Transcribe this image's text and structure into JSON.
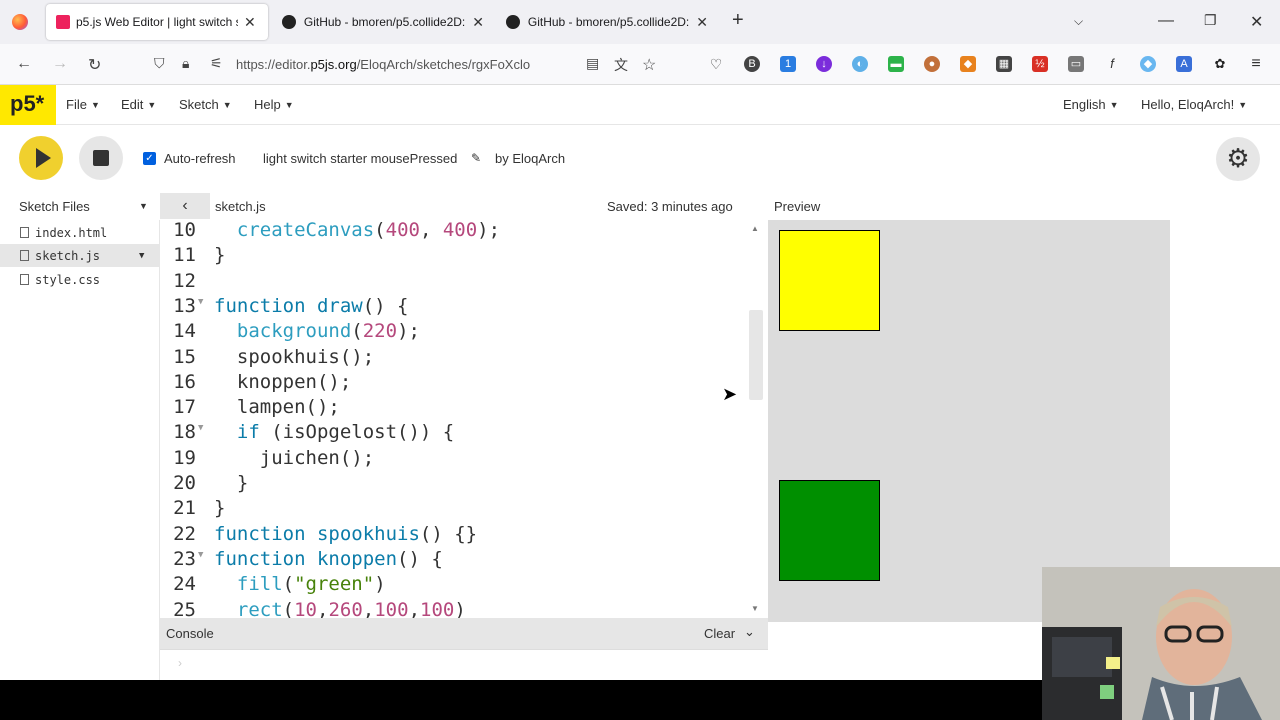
{
  "browser": {
    "tabs": [
      {
        "title": "p5.js Web Editor | light switch starte"
      },
      {
        "title": "GitHub - bmoren/p5.collide2D:"
      },
      {
        "title": "GitHub - bmoren/p5.collide2D:"
      }
    ],
    "url_prefix": "https://editor.",
    "url_domain": "p5js.org",
    "url_path": "/EloqArch/sketches/rgxFoXclo"
  },
  "app": {
    "logo": "p5*",
    "menu": [
      "File",
      "Edit",
      "Sketch",
      "Help"
    ],
    "language": "English",
    "greeting": "Hello, EloqArch!"
  },
  "toolbar": {
    "autorefresh_label": "Auto-refresh",
    "sketch_name": "light switch starter mousePressed",
    "author": "by EloqArch"
  },
  "files": {
    "header": "Sketch Files",
    "items": [
      "index.html",
      "sketch.js",
      "style.css"
    ]
  },
  "editor": {
    "filename": "sketch.js",
    "saved_status": "Saved: 3 minutes ago",
    "lines": [
      {
        "n": "10",
        "code": "  createCanvas(400, 400);"
      },
      {
        "n": "11",
        "code": "}"
      },
      {
        "n": "12",
        "code": ""
      },
      {
        "n": "13",
        "code": "function draw() {"
      },
      {
        "n": "14",
        "code": "  background(220);"
      },
      {
        "n": "15",
        "code": "  spookhuis();"
      },
      {
        "n": "16",
        "code": "  knoppen();"
      },
      {
        "n": "17",
        "code": "  lampen();"
      },
      {
        "n": "18",
        "code": "  if (isOpgelost()) {"
      },
      {
        "n": "19",
        "code": "    juichen();"
      },
      {
        "n": "20",
        "code": "  }"
      },
      {
        "n": "21",
        "code": "}"
      },
      {
        "n": "22",
        "code": "function spookhuis() {}"
      },
      {
        "n": "23",
        "code": "function knoppen() {"
      },
      {
        "n": "24",
        "code": "  fill(\"green\")"
      },
      {
        "n": "25",
        "code": "  rect(10,260,100,100)"
      }
    ]
  },
  "console": {
    "label": "Console",
    "clear_label": "Clear"
  },
  "preview": {
    "label": "Preview",
    "squares": [
      {
        "color": "#ffff00"
      },
      {
        "color": "#008f00"
      }
    ]
  },
  "colors": {
    "accent": "#ed225d",
    "play": "#f0d02e",
    "canvas_bg": "#dcdcdc"
  }
}
